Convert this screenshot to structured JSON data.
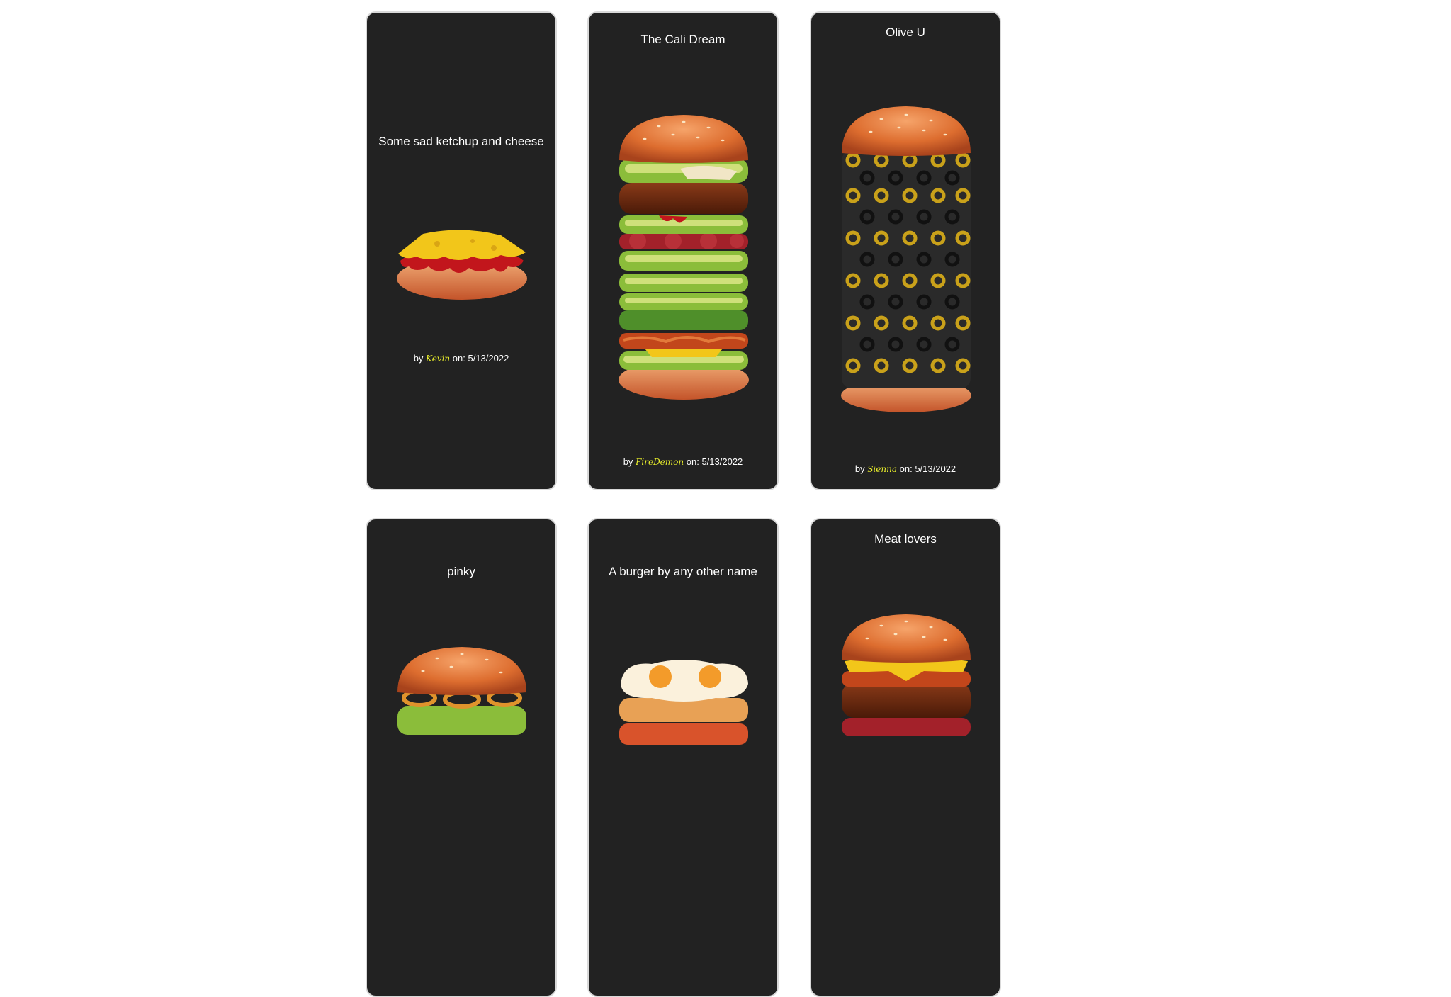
{
  "creations": [
    {
      "title": "Some sad ketchup and cheese",
      "by": "by",
      "author": "Kevin",
      "on": "on:",
      "date": "5/13/2022"
    },
    {
      "title": "The Cali Dream",
      "by": "by",
      "author": "FireDemon",
      "on": "on:",
      "date": "5/13/2022"
    },
    {
      "title": "Olive U",
      "by": "by",
      "author": "Sienna",
      "on": "on:",
      "date": "5/13/2022"
    },
    {
      "title": "pinky"
    },
    {
      "title": "A burger by any other name"
    },
    {
      "title": "Meat lovers"
    }
  ],
  "colors": {
    "card_background": "#222222",
    "card_border": "#d9d9d9",
    "author_highlight": "#e9ee2b",
    "text": "#ffffff"
  },
  "ingredient_icons": [
    "bun-top-icon",
    "cheese-icon",
    "ketchup-icon",
    "lettuce-icon",
    "avocado-icon",
    "salami-icon",
    "bacon-icon",
    "patty-icon",
    "olive-icon",
    "onion-ring-icon",
    "fried-egg-icon",
    "bun-bottom-icon"
  ]
}
